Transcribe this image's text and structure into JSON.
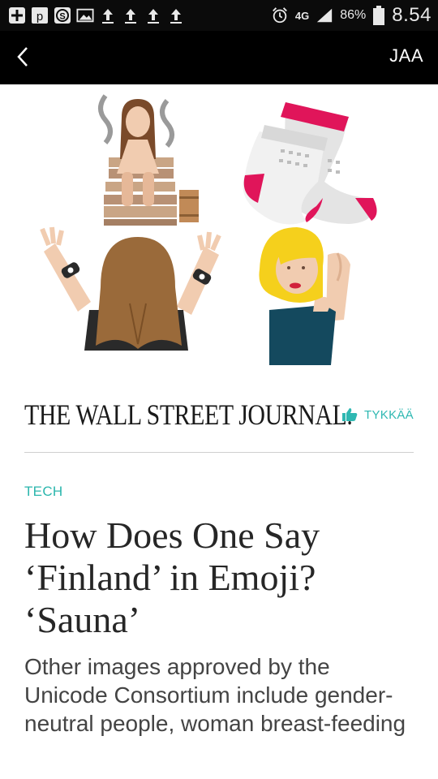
{
  "status_bar": {
    "network": "4G",
    "battery": "86%",
    "time": "8.54"
  },
  "navbar": {
    "share_label": "JAA"
  },
  "publisher": {
    "logo": "THE WALL STREET JOURNAL.",
    "like_label": "TYKKÄÄ"
  },
  "article": {
    "section": "TECH",
    "headline": "How Does One Say ‘Finland’ in Emoji? ‘Sauna’",
    "dek": "Other images approved by the Unicode Consortium include gender-neutral people, woman breast-feeding"
  },
  "colors": {
    "accent": "#2bb6ad",
    "navbar": "#000000"
  },
  "icons": [
    "plus-icon",
    "p-icon",
    "dollar-icon",
    "image-icon",
    "upload-icon",
    "alarm-icon",
    "signal-icon",
    "battery-icon",
    "back-chevron-icon",
    "thumbs-up-icon"
  ]
}
